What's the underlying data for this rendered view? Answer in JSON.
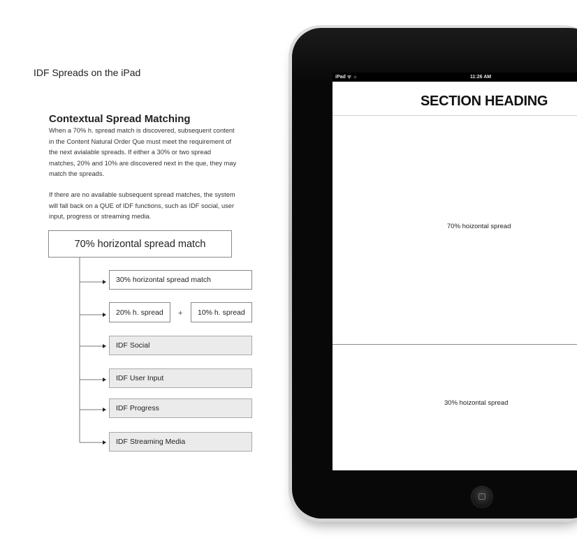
{
  "page": {
    "title": "IDF Spreads on the iPad"
  },
  "description": {
    "heading": "Contextual Spread Matching",
    "paragraph1": "When a 70% h. spread match is discovered, subsequent content in the Content Natural Order Que must meet the requirement of the next avialable spreads. If either a 30% or two spread matches, 20% and 10% are discovered next in the que, they may match the spreads.",
    "paragraph2": "If there are no available subsequent spread matches, the system will fall back on a QUE of IDF functions, such as IDF social, user input, progress or streaming media."
  },
  "flow": {
    "root": "70% horizontal spread match",
    "option_30": "30% horizontal spread match",
    "option_20": "20% h. spread",
    "plus": "+",
    "option_10": "10% h. spread",
    "fallbacks": [
      "IDF Social",
      "IDF User Input",
      "IDF Progress",
      "IDF Streaming Media"
    ]
  },
  "ipad": {
    "status_left": "iPad ᯤ ☼",
    "status_time": "11:26 AM",
    "section_heading": "SECTION HEADING",
    "spread_top": "70% hoizontal spread",
    "spread_bottom": "30% hoizontal spread"
  },
  "colors": {
    "fallback_box_fill": "#ebebeb",
    "bezel": "#080808",
    "status_bar": "#000000"
  }
}
